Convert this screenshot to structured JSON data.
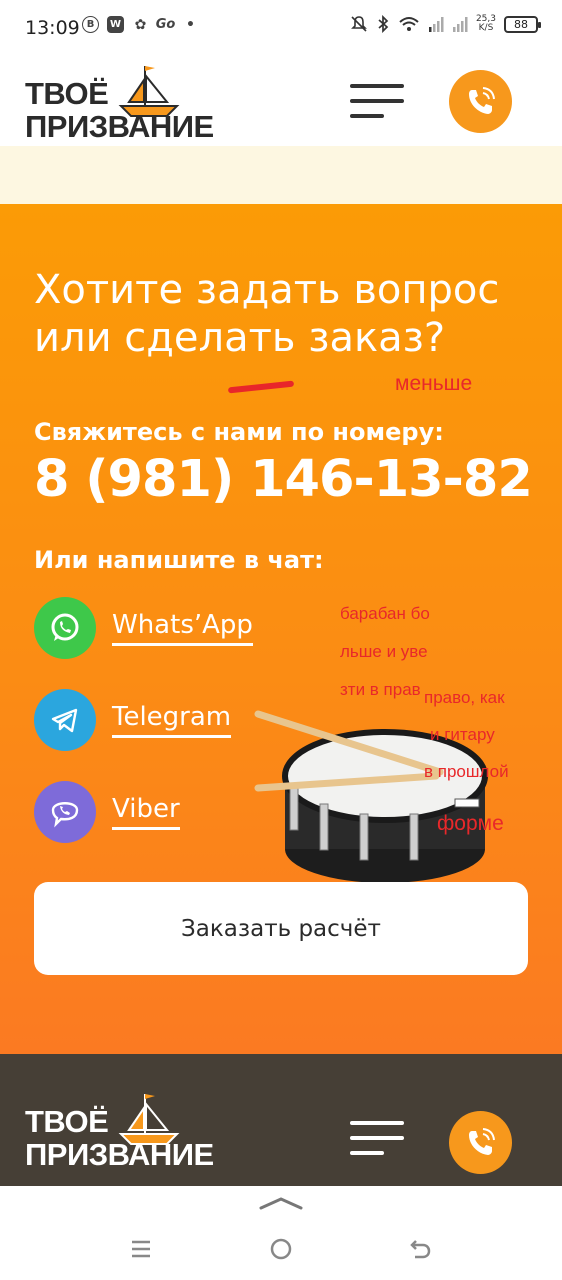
{
  "status_bar": {
    "time": "13:09",
    "net_speed_value": "25,3",
    "net_speed_unit": "K/S",
    "battery": "88"
  },
  "header": {
    "logo_line1": "ТВОЁ",
    "logo_line2": "ПРИЗВАНИЕ"
  },
  "contact": {
    "headline": "Хотите задать вопрос или сделать заказ?",
    "call_label": "Свяжитесь с нами по номеру:",
    "phone": "8 (981) 146-13-82",
    "chat_label": "Или напишите в чат:",
    "messengers": [
      {
        "label": "Whats’App",
        "color": "#3ec84a"
      },
      {
        "label": "Telegram",
        "color": "#2ba6de"
      },
      {
        "label": "Viber",
        "color": "#7e6bd9"
      }
    ],
    "order_button": "Заказать расчёт"
  },
  "annotations": {
    "note_smaller": "меньше",
    "note_drum_1": "барабан бо",
    "note_drum_2": "льше и уве",
    "note_drum_3": "зти в прав",
    "note_drum_4": "право, как",
    "note_drum_5": "и гитару",
    "note_drum_6": "в прошлой",
    "note_drum_7": "форме"
  },
  "footer": {
    "logo_line1": "ТВОЁ",
    "logo_line2": "ПРИЗВАНИЕ"
  },
  "colors": {
    "accent_orange": "#f7981c",
    "footer_bg": "#463f36",
    "annotation_red": "#e8282a"
  }
}
